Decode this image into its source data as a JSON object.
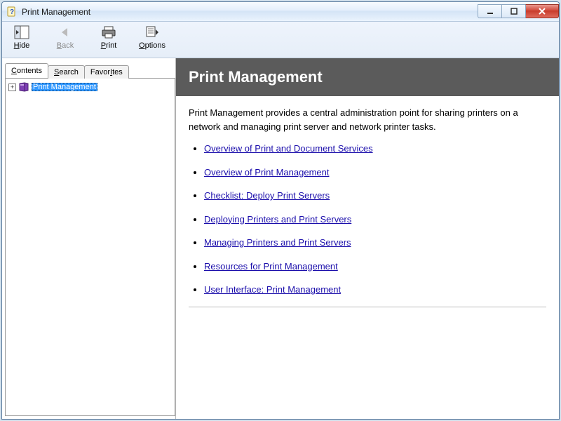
{
  "window": {
    "title": "Print Management"
  },
  "toolbar": {
    "hide": {
      "label": "Hide",
      "accel": "H"
    },
    "back": {
      "label": "Back",
      "accel": "B",
      "enabled": false
    },
    "print": {
      "label": "Print",
      "accel": "P"
    },
    "options": {
      "label": "Options",
      "accel": "O"
    }
  },
  "nav": {
    "tabs": {
      "contents": {
        "label": "Contents",
        "accel": "C",
        "active": true
      },
      "search": {
        "label": "Search",
        "accel": "S"
      },
      "favorites": {
        "label": "Favorites",
        "accel": "I"
      }
    },
    "tree": {
      "root": {
        "label": "Print Management",
        "selected": true,
        "expanded": false
      }
    }
  },
  "content": {
    "heading": "Print Management",
    "intro": "Print Management provides a central administration point for sharing printers on a network and managing print server and network printer tasks.",
    "links": [
      "Overview of Print and Document Services",
      "Overview of Print Management",
      "Checklist: Deploy Print Servers",
      "Deploying Printers and Print Servers",
      "Managing Printers and Print Servers",
      "Resources for Print Management",
      "User Interface: Print Management"
    ]
  }
}
